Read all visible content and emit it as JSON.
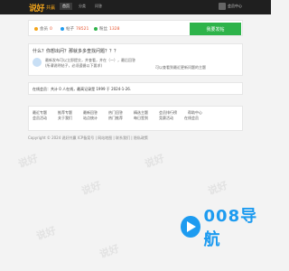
{
  "header": {
    "logo_main": "说好",
    "logo_sub": "共赢",
    "nav": [
      "首页",
      "分类",
      "问答"
    ],
    "user_label": "会员中心"
  },
  "stats": {
    "a_label": "会员",
    "a_value": "0",
    "b_label": "帖子",
    "b_value": "78521",
    "c_label": "粉丝",
    "c_value": "1328",
    "post_button": "我要发帖"
  },
  "question": {
    "title": "什么？你想出问？那就多多查找问题？？？",
    "lines": [
      "最新发布可以立即提交，并查看，并在（一），最后回答",
      "(所谓说明帖子，必须遵循以下要求)"
    ],
    "right_text": "可以查看到最近更新问题的主题"
  },
  "notice": {
    "text": "在线会员：共计 0 人在线，最高记录是 1999 于 2024-1-26."
  },
  "links": {
    "row1": [
      "最近专题",
      "推荐专题",
      "最新回答",
      "热门回答",
      "精选主题",
      "会员排行榜",
      "帮助中心"
    ],
    "row2": [
      "会员活动",
      "关于我们",
      "站点统计",
      "热门推荐",
      "每日签到",
      "竞赛活动",
      "在线会员"
    ]
  },
  "footer": {
    "text": "Copyright © 2024 说好共赢 ICP备案号 | 网站地图 | 联系我们 | 隐私政策"
  },
  "watermark": {
    "text": "说好"
  },
  "brand": {
    "text": "008导航"
  },
  "colors": {
    "accent": "#2eb34a",
    "brand": "#1d9bf0",
    "logo": "#f3a51b",
    "highlight": "#e8542e"
  }
}
